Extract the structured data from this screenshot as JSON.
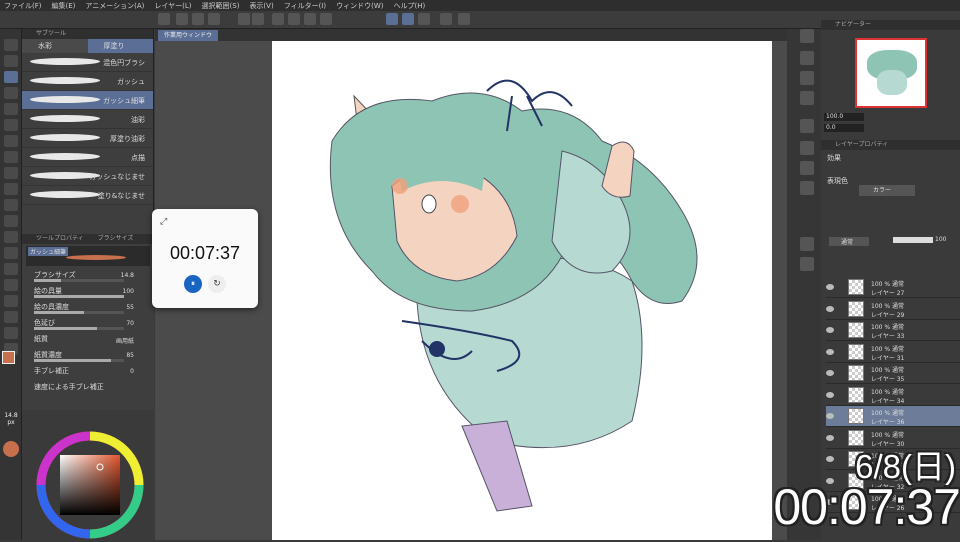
{
  "menu": [
    "ファイル(F)",
    "編集(E)",
    "アニメーション(A)",
    "レイヤー(L)",
    "選択範囲(S)",
    "表示(V)",
    "フィルター(I)",
    "ウィンドウ(W)",
    "ヘルプ(H)"
  ],
  "subtool": {
    "header": "サブツール",
    "tabs": [
      "水彩",
      "厚塗り"
    ],
    "brushes": [
      "混色円ブラシ",
      "ガッシュ",
      "ガッシュ細筆",
      "油彩",
      "厚塗り油彩",
      "点描",
      "ガッシュなじませ",
      "塗り&なじませ"
    ],
    "selected_index": 2
  },
  "toolprop": {
    "header": "ツールプロパティ",
    "header2": "ブラシサイズ",
    "brush_name": "ガッシュ細筆",
    "rows": [
      {
        "label": "ブラシサイズ",
        "value": "14.8",
        "fill": 0.3
      },
      {
        "label": "絵の具量",
        "value": "100",
        "fill": 1.0
      },
      {
        "label": "絵の具濃度",
        "value": "55",
        "fill": 0.55
      },
      {
        "label": "色延び",
        "value": "70",
        "fill": 0.7
      },
      {
        "label": "紙質",
        "value": "画用紙",
        "fill": 0
      },
      {
        "label": "紙質濃度",
        "value": "85",
        "fill": 0.85
      },
      {
        "label": "手ブレ補正",
        "value": "0",
        "fill": 0
      },
      {
        "label": "速度による手ブレ補正",
        "value": "",
        "fill": 0
      }
    ]
  },
  "size_indicator": {
    "value": "14.8",
    "unit": "px"
  },
  "document": {
    "tab": "作業用ウィンドウ"
  },
  "timer": {
    "time": "00:07:37",
    "pause": "⏸",
    "reset": "↻",
    "expand": "⤢"
  },
  "navigator": {
    "header": "ナビゲーター",
    "zoom": "100.0",
    "rotate": "0.0"
  },
  "layer_property": {
    "header": "レイヤープロパティ",
    "effect": "効果",
    "expression_label": "表現色",
    "expression_value": "カラー"
  },
  "layers": {
    "blend": "通常",
    "opacity": "100",
    "items": [
      {
        "pct": "100 % 通常",
        "name": "レイヤー 27",
        "selected": false
      },
      {
        "pct": "100 % 通常",
        "name": "レイヤー 29",
        "selected": false
      },
      {
        "pct": "100 % 通常",
        "name": "レイヤー 33",
        "selected": false
      },
      {
        "pct": "100 % 通常",
        "name": "レイヤー 31",
        "selected": false
      },
      {
        "pct": "100 % 通常",
        "name": "レイヤー 35",
        "selected": false
      },
      {
        "pct": "100 % 通常",
        "name": "レイヤー 34",
        "selected": false
      },
      {
        "pct": "100 % 通常",
        "name": "レイヤー 36",
        "selected": true
      },
      {
        "pct": "100 % 通常",
        "name": "レイヤー 30",
        "selected": false
      },
      {
        "pct": "100 % 通常",
        "name": "レイヤー 28",
        "selected": false
      },
      {
        "pct": "100 % 通常",
        "name": "レイヤー 32",
        "selected": false
      },
      {
        "pct": "100 % 通常",
        "name": "レイヤー 26",
        "selected": false
      }
    ]
  },
  "overlay": {
    "date": "6/8(日)",
    "clock": "00:07:37"
  },
  "colors": {
    "accent": "#5a6e96",
    "hair": "#8ec4b4",
    "skin": "#f4d3c0",
    "cheek": "#f0a07c",
    "dress": "#b6dad2",
    "line": "#223366",
    "legs": "#c9b0d8"
  }
}
